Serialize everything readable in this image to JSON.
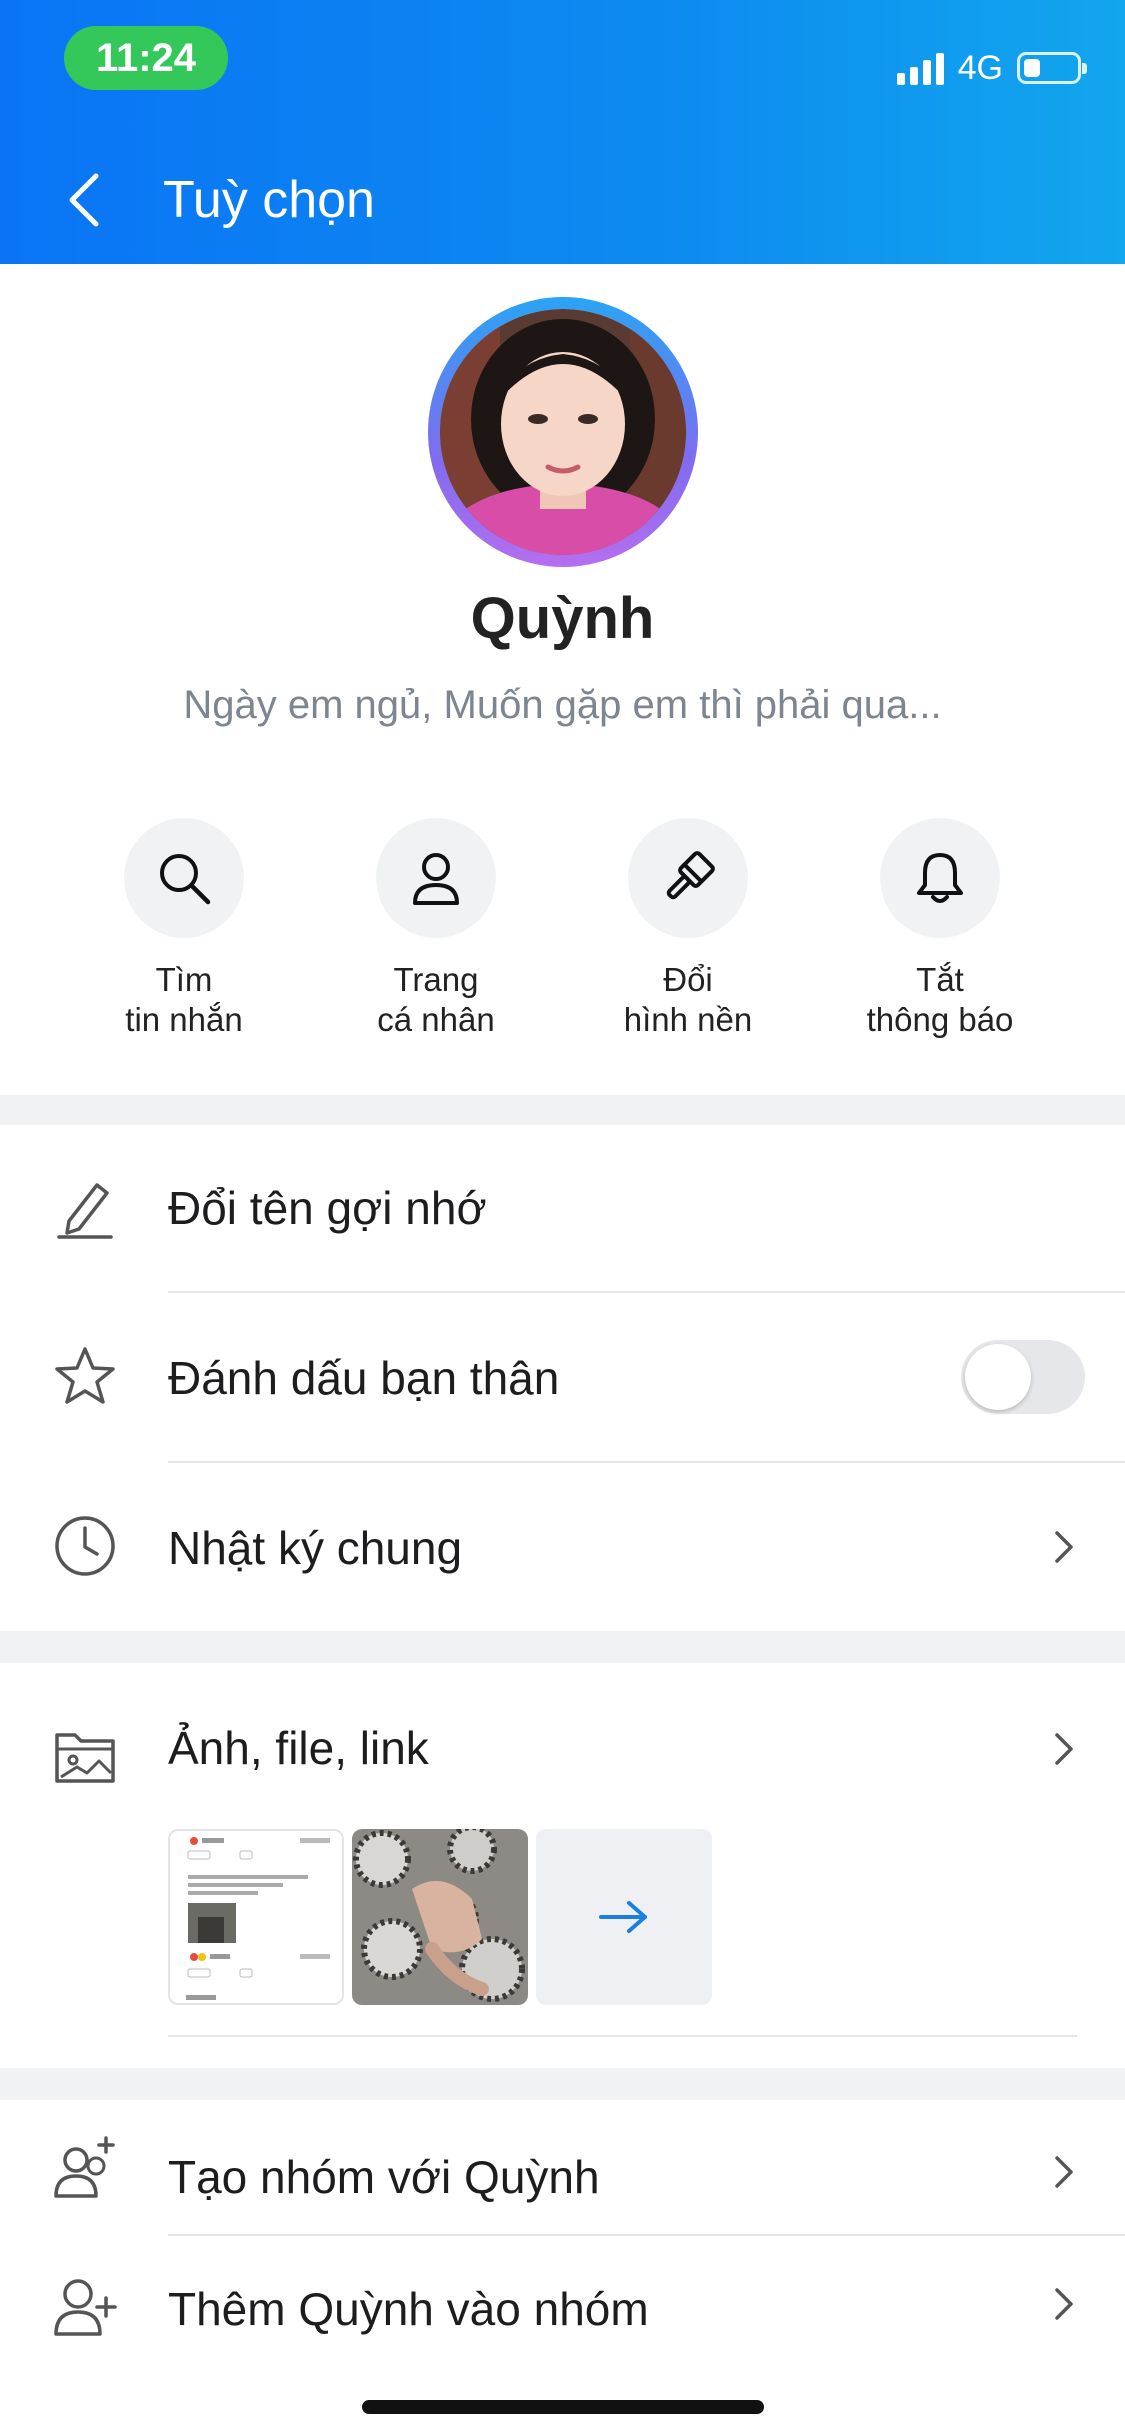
{
  "status_bar": {
    "time": "11:24",
    "network": "4G",
    "battery_level": 0.3
  },
  "header": {
    "title": "Tuỳ chọn",
    "back_icon": "chevron-left-icon"
  },
  "profile": {
    "name": "Quỳnh",
    "status": "Ngày em ngủ, Muốn gặp em thì phải qua..."
  },
  "actions": [
    {
      "icon": "search-icon",
      "label_line1": "Tìm",
      "label_line2": "tin nhắn"
    },
    {
      "icon": "person-icon",
      "label_line1": "Trang",
      "label_line2": "cá nhân"
    },
    {
      "icon": "paint-brush-icon",
      "label_line1": "Đổi",
      "label_line2": "hình nền"
    },
    {
      "icon": "bell-icon",
      "label_line1": "Tắt",
      "label_line2": "thông báo"
    }
  ],
  "menu": {
    "rename": {
      "label": "Đổi tên gợi nhớ",
      "icon": "pencil-icon"
    },
    "best_friend": {
      "label": "Đánh dấu bạn thân",
      "icon": "star-icon",
      "enabled": false
    },
    "diary": {
      "label": "Nhật ký chung",
      "icon": "clock-icon"
    },
    "media": {
      "label": "Ảnh, file, link",
      "icon": "photo-folder-icon",
      "more_icon": "arrow-right-icon"
    },
    "create_group": {
      "label": "Tạo nhóm với Quỳnh",
      "icon": "add-group-icon"
    },
    "add_to_group": {
      "label": "Thêm Quỳnh vào nhóm",
      "icon": "add-person-icon"
    }
  },
  "colors": {
    "header_start": "#0a74f5",
    "header_end": "#12a6ee",
    "accent": "#0a74f5",
    "time_pill": "#34c759"
  }
}
